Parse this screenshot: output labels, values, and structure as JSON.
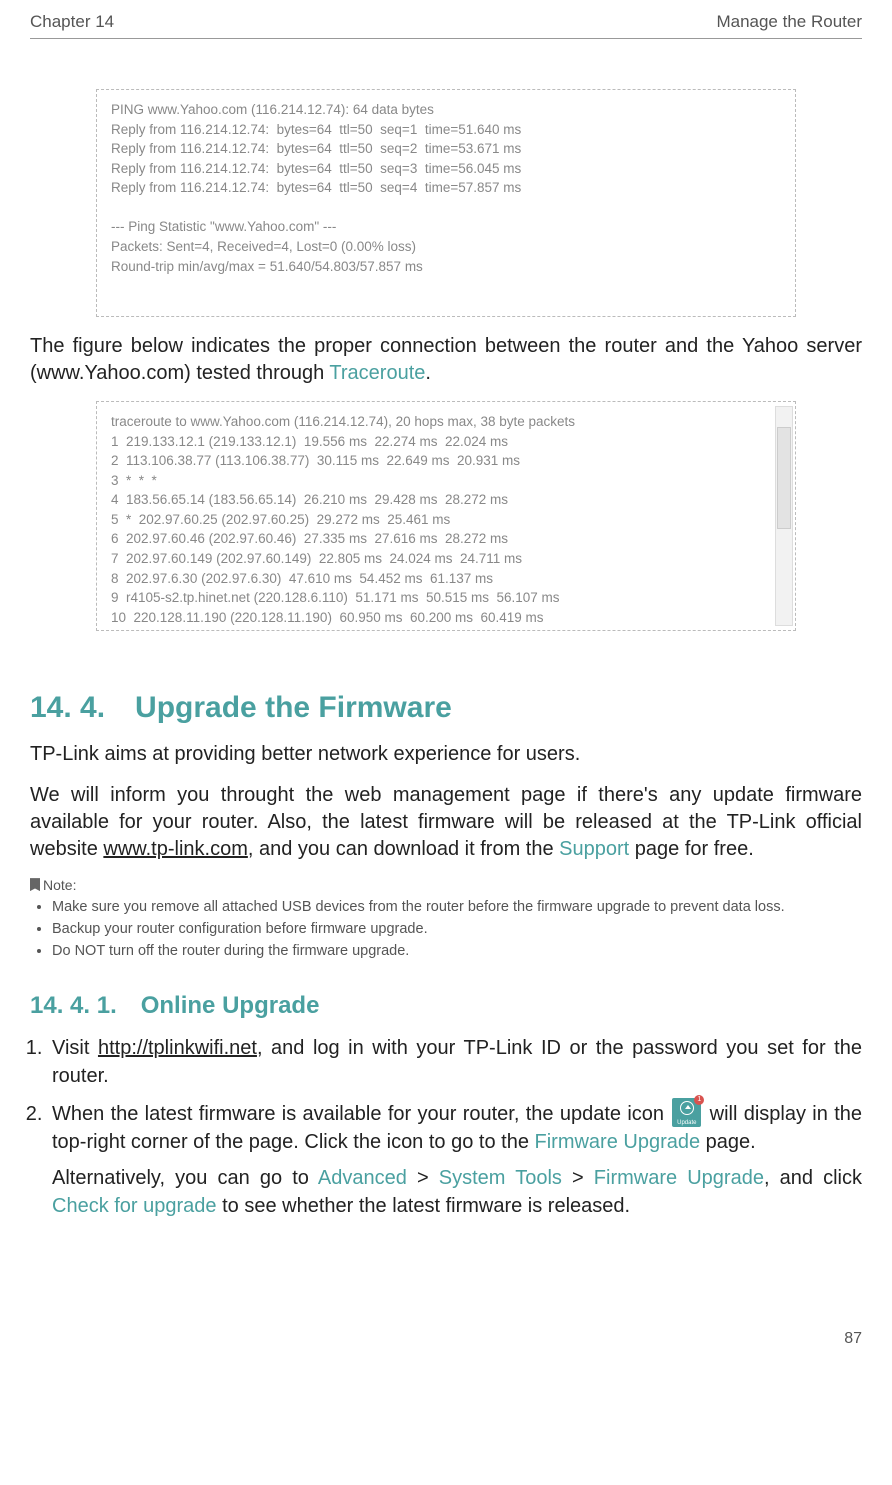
{
  "header": {
    "left": "Chapter 14",
    "right": "Manage the Router"
  },
  "ping": "PING www.Yahoo.com (116.214.12.74): 64 data bytes\nReply from 116.214.12.74:  bytes=64  ttl=50  seq=1  time=51.640 ms\nReply from 116.214.12.74:  bytes=64  ttl=50  seq=2  time=53.671 ms\nReply from 116.214.12.74:  bytes=64  ttl=50  seq=3  time=56.045 ms\nReply from 116.214.12.74:  bytes=64  ttl=50  seq=4  time=57.857 ms\n\n--- Ping Statistic \"www.Yahoo.com\" ---\nPackets: Sent=4, Received=4, Lost=0 (0.00% loss)\nRound-trip min/avg/max = 51.640/54.803/57.857 ms",
  "para1_pre": "The figure below indicates the proper connection between the router and the Yahoo server (www.Yahoo.com) tested through ",
  "para1_em": "Traceroute",
  "para1_post": ".",
  "trace": "traceroute to www.Yahoo.com (116.214.12.74), 20 hops max, 38 byte packets\n1  219.133.12.1 (219.133.12.1)  19.556 ms  22.274 ms  22.024 ms\n2  113.106.38.77 (113.106.38.77)  30.115 ms  22.649 ms  20.931 ms\n3  *  *  *\n4  183.56.65.14 (183.56.65.14)  26.210 ms  29.428 ms  28.272 ms\n5  *  202.97.60.25 (202.97.60.25)  29.272 ms  25.461 ms\n6  202.97.60.46 (202.97.60.46)  27.335 ms  27.616 ms  28.272 ms\n7  202.97.60.149 (202.97.60.149)  22.805 ms  24.024 ms  24.711 ms\n8  202.97.6.30 (202.97.6.30)  47.610 ms  54.452 ms  61.137 ms\n9  r4105-s2.tp.hinet.net (220.128.6.110)  51.171 ms  50.515 ms  56.107 ms\n10  220.128.11.190 (220.128.11.190)  60.950 ms  60.200 ms  60.419 ms",
  "h1": "14. 4. Upgrade the Firmware",
  "p2": "TP-Link aims at providing better network experience for users.",
  "p3_a": "We will inform you throught the web management page if there's any update firmware available for your router. Also, the latest firmware will be released at the TP-Link official website ",
  "p3_link": "www.tp-link.com",
  "p3_b": ", and you can download it from the ",
  "p3_em": "Support",
  "p3_c": " page for free.",
  "note_label": "Note:",
  "notes": [
    "Make sure you remove all attached USB devices  from the router before the firmware upgrade to prevent data loss.",
    "Backup your router configuration before firmware upgrade.",
    "Do NOT turn off the router during the firmware upgrade."
  ],
  "h2": "14. 4. 1. Online Upgrade",
  "step1_a": "Visit ",
  "step1_link": "http://tplinkwifi.net",
  "step1_b": ", and log in with your TP-Link ID or the password you set for the router.",
  "step2_a": "When the latest firmware is available for your router, the update icon ",
  "icon_label": "Update",
  "icon_badge": "1",
  "step2_b": " will display in the top-right corner of the page. Click the icon to go to the ",
  "step2_em1": "Firmware Upgrade",
  "step2_c": " page.",
  "step2_d": "Alternatively, you can go to ",
  "step2_em2": "Advanced",
  "gt1": " > ",
  "step2_em3": "System Tools",
  "gt2": " > ",
  "step2_em4": "Firmware Upgrade",
  "step2_e": ", and click ",
  "step2_em5": "Check for upgrade",
  "step2_f": " to see whether the latest firmware is released.",
  "pagenum": "87"
}
